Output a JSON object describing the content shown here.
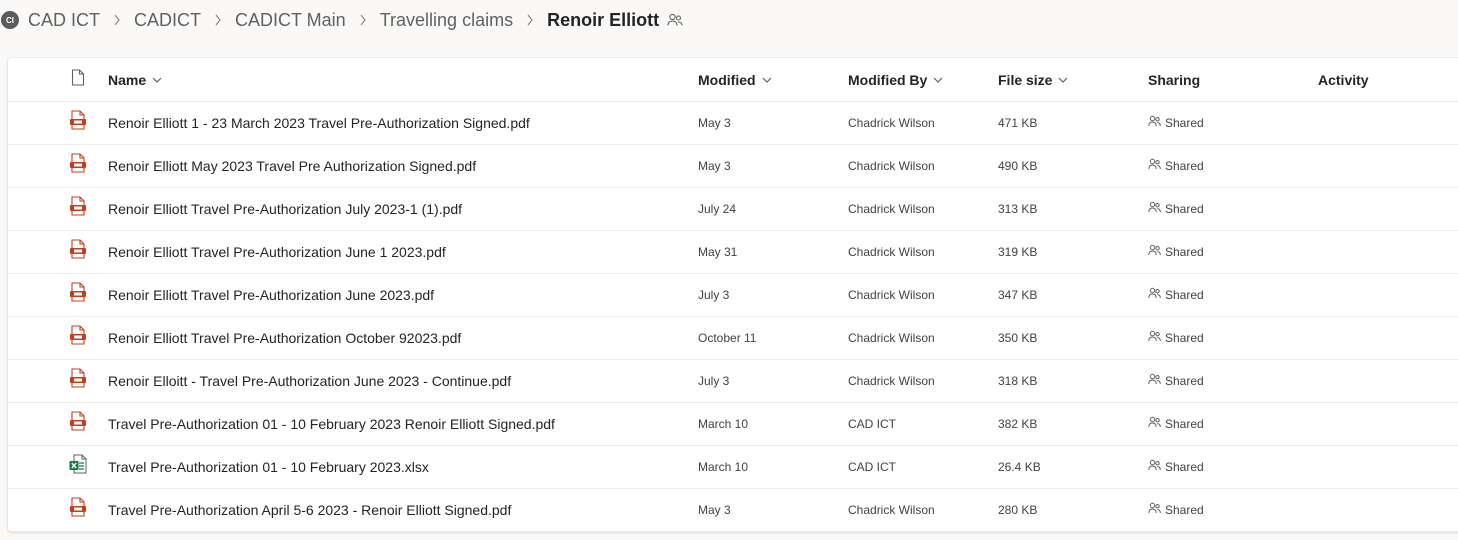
{
  "breadcrumb": {
    "site_badge": "CI",
    "items": [
      "CAD ICT",
      "CADICT",
      "CADICT Main",
      "Travelling claims"
    ],
    "current": "Renoir Elliott",
    "shared_icon": "people-icon"
  },
  "columns": {
    "file_type": "file-type-icon",
    "name": "Name",
    "modified": "Modified",
    "modified_by": "Modified By",
    "file_size": "File size",
    "sharing": "Sharing",
    "activity": "Activity"
  },
  "files": [
    {
      "type": "pdf",
      "name": "Renoir Elliott 1 - 23 March 2023 Travel Pre-Authorization Signed.pdf",
      "modified": "May 3",
      "modified_by": "Chadrick Wilson",
      "size": "471 KB",
      "sharing": "Shared"
    },
    {
      "type": "pdf",
      "name": "Renoir Elliott May 2023 Travel Pre Authorization Signed.pdf",
      "modified": "May 3",
      "modified_by": "Chadrick Wilson",
      "size": "490 KB",
      "sharing": "Shared"
    },
    {
      "type": "pdf",
      "name": "Renoir Elliott Travel Pre-Authorization July 2023-1 (1).pdf",
      "modified": "July 24",
      "modified_by": "Chadrick Wilson",
      "size": "313 KB",
      "sharing": "Shared"
    },
    {
      "type": "pdf",
      "name": "Renoir Elliott Travel Pre-Authorization June 1 2023.pdf",
      "modified": "May 31",
      "modified_by": "Chadrick Wilson",
      "size": "319 KB",
      "sharing": "Shared"
    },
    {
      "type": "pdf",
      "name": "Renoir Elliott Travel Pre-Authorization June 2023.pdf",
      "modified": "July 3",
      "modified_by": "Chadrick Wilson",
      "size": "347 KB",
      "sharing": "Shared"
    },
    {
      "type": "pdf",
      "name": "Renoir Elliott Travel Pre-Authorization October 92023.pdf",
      "modified": "October 11",
      "modified_by": "Chadrick Wilson",
      "size": "350 KB",
      "sharing": "Shared"
    },
    {
      "type": "pdf",
      "name": "Renoir Elloitt - Travel Pre-Authorization June 2023 - Continue.pdf",
      "modified": "July 3",
      "modified_by": "Chadrick Wilson",
      "size": "318 KB",
      "sharing": "Shared"
    },
    {
      "type": "pdf",
      "name": "Travel Pre-Authorization 01 - 10 February 2023 Renoir Elliott Signed.pdf",
      "modified": "March 10",
      "modified_by": "CAD ICT",
      "size": "382 KB",
      "sharing": "Shared"
    },
    {
      "type": "xlsx",
      "name": "Travel Pre-Authorization 01 - 10 February 2023.xlsx",
      "modified": "March 10",
      "modified_by": "CAD ICT",
      "size": "26.4 KB",
      "sharing": "Shared"
    },
    {
      "type": "pdf",
      "name": "Travel Pre-Authorization April 5-6  2023 - Renoir Elliott Signed.pdf",
      "modified": "May 3",
      "modified_by": "Chadrick Wilson",
      "size": "280 KB",
      "sharing": "Shared"
    }
  ],
  "colors": {
    "pdf_red": "#c43e1c",
    "excel_green": "#107c41",
    "text": "#242424",
    "muted": "#616161"
  }
}
